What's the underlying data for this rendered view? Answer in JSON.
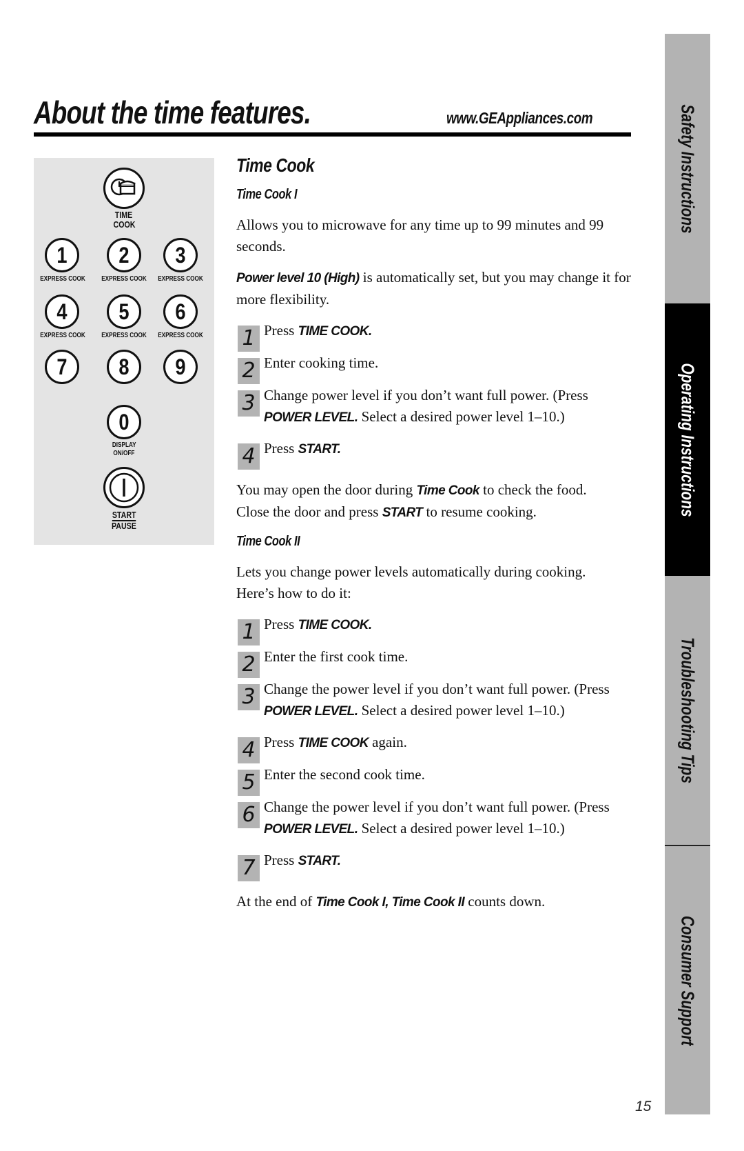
{
  "header": {
    "title": "About the time features.",
    "url": "www.GEAppliances.com"
  },
  "keypad": {
    "time_cook_label_line1": "TIME",
    "time_cook_label_line2": "COOK",
    "keys": [
      {
        "digit": "1",
        "label": "EXPRESS COOK"
      },
      {
        "digit": "2",
        "label": "EXPRESS COOK"
      },
      {
        "digit": "3",
        "label": "EXPRESS COOK"
      },
      {
        "digit": "4",
        "label": "EXPRESS COOK"
      },
      {
        "digit": "5",
        "label": "EXPRESS COOK"
      },
      {
        "digit": "6",
        "label": "EXPRESS COOK"
      },
      {
        "digit": "7",
        "label": ""
      },
      {
        "digit": "8",
        "label": ""
      },
      {
        "digit": "9",
        "label": ""
      }
    ],
    "zero": {
      "digit": "0",
      "label_line1": "DISPLAY",
      "label_line2": "ON/OFF"
    },
    "start": {
      "label_line1": "START",
      "label_line2": "PAUSE"
    }
  },
  "content": {
    "section_title": "Time Cook",
    "time_cook_1": {
      "title": "Time Cook I",
      "intro": "Allows you to microwave for any time up to 99 minutes and 99 seconds.",
      "power_bold": "Power level 10 (High)",
      "power_rest": " is automatically set, but you may change it for more flexibility.",
      "steps": [
        {
          "num": "1",
          "pre": "Press ",
          "bold": "TIME COOK.",
          "post": ""
        },
        {
          "num": "2",
          "pre": "Enter cooking time.",
          "bold": "",
          "post": ""
        },
        {
          "num": "3",
          "pre": "Change power level if you don’t want full power. (Press ",
          "bold": "POWER LEVEL.",
          "post": " Select a desired power level 1–10.)"
        },
        {
          "num": "4",
          "pre": "Press ",
          "bold": "START.",
          "post": ""
        }
      ],
      "note_pre": "You may open the door during ",
      "note_bold1": "Time Cook",
      "note_mid": " to check the food. Close the door and press ",
      "note_bold2": "START",
      "note_post": " to resume cooking."
    },
    "time_cook_2": {
      "title": "Time Cook II",
      "intro": "Lets you change power levels automatically during cooking. Here’s how to do it:",
      "steps": [
        {
          "num": "1",
          "pre": "Press ",
          "bold": "TIME COOK.",
          "post": ""
        },
        {
          "num": "2",
          "pre": "Enter the first cook time.",
          "bold": "",
          "post": ""
        },
        {
          "num": "3",
          "pre": "Change the power level if you don’t want full power. (Press ",
          "bold": "POWER LEVEL.",
          "post": " Select a desired power level 1–10.)"
        },
        {
          "num": "4",
          "pre": "Press ",
          "bold": "TIME COOK",
          "post": " again."
        },
        {
          "num": "5",
          "pre": "Enter the second cook time.",
          "bold": "",
          "post": ""
        },
        {
          "num": "6",
          "pre": "Change the power level if you don’t want full power. (Press ",
          "bold": "POWER LEVEL.",
          "post": " Select a desired power level 1–10.)"
        },
        {
          "num": "7",
          "pre": "Press ",
          "bold": "START.",
          "post": ""
        }
      ],
      "end_pre": "At the end of ",
      "end_bold": "Time Cook I, Time Cook II",
      "end_post": " counts down."
    }
  },
  "side_tabs": [
    {
      "label": "Safety Instructions",
      "active": false
    },
    {
      "label": "Operating Instructions",
      "active": true
    },
    {
      "label": "Troubleshooting Tips",
      "active": false
    },
    {
      "label": "Consumer Support",
      "active": false
    }
  ],
  "page_number": "15",
  "colors": {
    "tab_gray": "#b3b3b3",
    "tab_active": "#000000",
    "keypad_bg": "#e4e4e4",
    "step_badge": "#b3b3b3"
  }
}
